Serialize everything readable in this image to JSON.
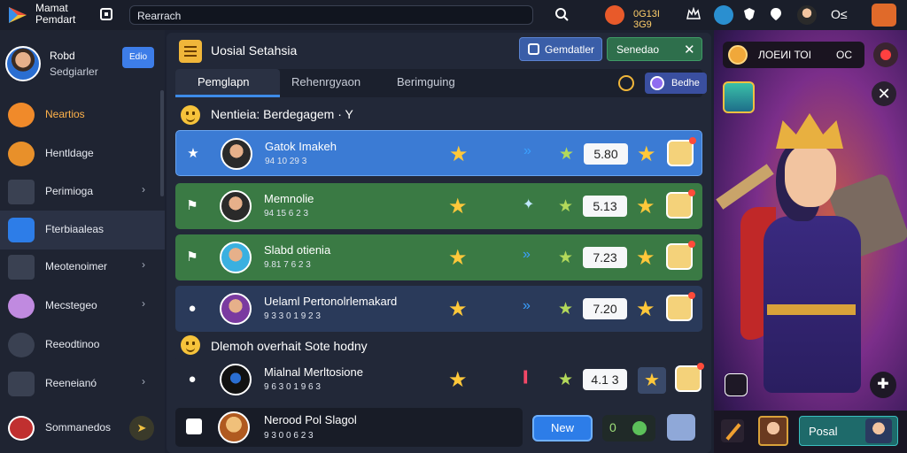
{
  "topbar": {
    "brand_line1": "Mamat",
    "brand_line2": "Pemdart",
    "search_value": "Rearrach",
    "coins": "0G13I 3G9",
    "profile_label": "O≤"
  },
  "sidebar": {
    "profile_name": "Robd",
    "profile_sub": "Sedgiarler",
    "edit_label": "Edio",
    "items": [
      {
        "label": "Neartios",
        "icon": "flame-icon",
        "color": "#f08a2a"
      },
      {
        "label": "Hentldage",
        "icon": "medal-icon",
        "color": "#e8902a"
      },
      {
        "label": "Perimioga",
        "icon": "folder-icon",
        "color": "#5a6278"
      },
      {
        "label": "Fterbiaaleas",
        "icon": "shield-icon",
        "color": "#2d7de8"
      },
      {
        "label": "Meotenoimer",
        "icon": "folder-icon",
        "color": "#5a6278"
      },
      {
        "label": "Mecstegeo",
        "icon": "avatar-icon",
        "color": "#c08ae0"
      },
      {
        "label": "Reeodtinoo",
        "icon": "user-icon",
        "color": "#5a6278"
      },
      {
        "label": "Reeneianó",
        "icon": "lock-icon",
        "color": "#5a6278"
      },
      {
        "label": "Sommanedos",
        "icon": "character-icon",
        "color": "#c03030"
      }
    ]
  },
  "main": {
    "title": "Uosial Setahsia",
    "calc_label": "Gemdatler",
    "send_label": "Senedao",
    "tabs": [
      "Pemglapn",
      "Rehenrgyaon",
      "Berimguing"
    ],
    "tab_button": "Bedhe",
    "section1": "Nentieia: Berdegagem · Y",
    "section2": "Dlemoh overhait Sote hodny",
    "rows": [
      {
        "name": "Gatok Imakeh",
        "sub": "94 10 29 3",
        "score": "5.80",
        "color": "#3b7bd4",
        "lead": "star-icon"
      },
      {
        "name": "Memnolie",
        "sub": "94 15 6 2 3",
        "score": "5.13",
        "color": "#3a7a44",
        "lead": "flag-icon"
      },
      {
        "name": "Slabd otienia",
        "sub": "9.81 7 6 2 3",
        "score": "7.23",
        "color": "#3a7a44",
        "lead": "flag-icon"
      },
      {
        "name": "Uelaml Pertonolrlemakard",
        "sub": "9 3 3 0 1 9 2 3",
        "score": "7.20",
        "color": "#2a3a5a",
        "lead": "user-icon"
      },
      {
        "name": "Mialnal Merltosione",
        "sub": "9 6 3 0 1 9 6 3",
        "score": "4.1 3",
        "color": "#222838",
        "lead": "user-icon"
      }
    ],
    "bottom": {
      "name": "Nerood Pol Slagol",
      "sub": "9 3 0 0 6 2 3"
    },
    "new_label": "New",
    "toggle_value": "0"
  },
  "game": {
    "coin_label": "ЛОЕИІ ТОІ",
    "coin_count": "OC",
    "postal_label": "Posal"
  }
}
